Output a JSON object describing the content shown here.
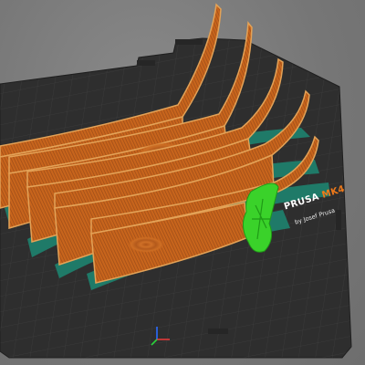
{
  "viewport": {
    "bed_brand": "PRUSA",
    "bed_model": "MK4",
    "bed_subtitle": "by Josef Prusa",
    "colors": {
      "background": "#7a7a7a",
      "bed": "#2d2d2d",
      "grid": "#3c3c3c",
      "part_orange": "#c8651c",
      "part_edge": "#e3a257",
      "brim_teal": "#1f7a68",
      "support_green": "#3ad22a"
    },
    "parts": [
      {
        "name": "curved-panel-1"
      },
      {
        "name": "curved-panel-2"
      },
      {
        "name": "curved-panel-3"
      },
      {
        "name": "curved-panel-4"
      },
      {
        "name": "curved-panel-5"
      }
    ],
    "axes": {
      "x": "x",
      "y": "y",
      "z": "z"
    }
  }
}
